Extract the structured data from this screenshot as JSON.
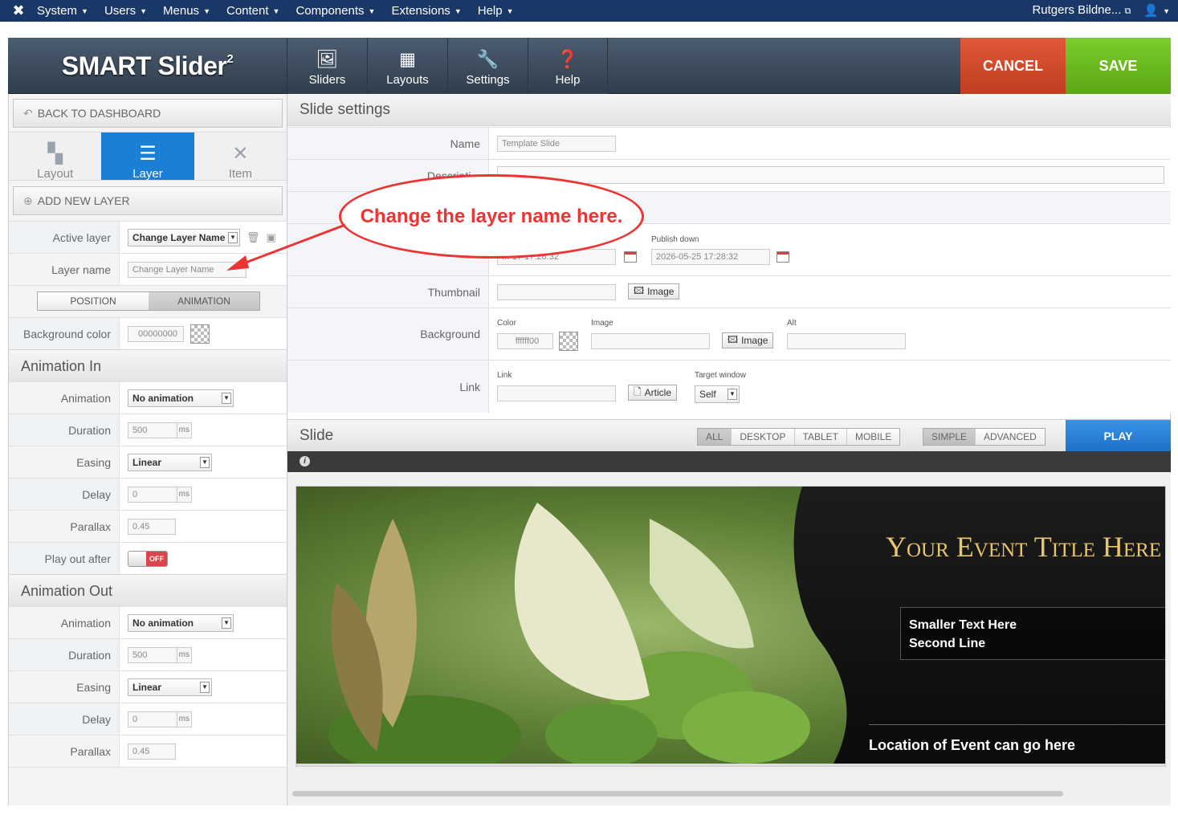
{
  "topbar": {
    "menu": [
      "System",
      "Users",
      "Menus",
      "Content",
      "Components",
      "Extensions",
      "Help"
    ],
    "user": "Rutgers Bildne...",
    "user_icon": "person-icon"
  },
  "header": {
    "brand_text": "SMART Slider",
    "brand_sup": "2",
    "nav": [
      {
        "label": "Sliders",
        "icon": "image-icon"
      },
      {
        "label": "Layouts",
        "icon": "layout-icon"
      },
      {
        "label": "Settings",
        "icon": "wrench-icon"
      },
      {
        "label": "Help",
        "icon": "question-icon"
      }
    ],
    "cancel_label": "CANCEL",
    "save_label": "SAVE"
  },
  "left": {
    "back_label": "BACK TO DASHBOARD",
    "tabs": [
      "Layout",
      "Layer",
      "Item"
    ],
    "add_layer_label": "ADD NEW LAYER",
    "active_layer_label": "Active layer",
    "active_layer_value": "Change Layer Name",
    "layer_name_label": "Layer name",
    "layer_name_value": "Change Layer Name",
    "seg": [
      "POSITION",
      "ANIMATION"
    ],
    "bg_color_label": "Background color",
    "bg_color_value": "00000000",
    "anim_in": {
      "title": "Animation In",
      "animation_label": "Animation",
      "animation_value": "No animation",
      "duration_label": "Duration",
      "duration_value": "500",
      "duration_unit": "ms",
      "easing_label": "Easing",
      "easing_value": "Linear",
      "delay_label": "Delay",
      "delay_value": "0",
      "delay_unit": "ms",
      "parallax_label": "Parallax",
      "parallax_value": "0.45",
      "playout_label": "Play out after",
      "playout_value": "OFF"
    },
    "anim_out": {
      "title": "Animation Out",
      "animation_label": "Animation",
      "animation_value": "No animation",
      "duration_label": "Duration",
      "duration_value": "500",
      "duration_unit": "ms",
      "easing_label": "Easing",
      "easing_value": "Linear",
      "delay_label": "Delay",
      "delay_value": "0",
      "delay_unit": "ms",
      "parallax_label": "Parallax",
      "parallax_value": "0.45"
    }
  },
  "right": {
    "settings_title": "Slide settings",
    "name_label": "Name",
    "name_value": "Template Slide",
    "description_label": "Descripti...",
    "publish_label": "Pu...",
    "publish_up_value": "...-17 17:28:32",
    "publish_down_label": "Publish down",
    "publish_down_value": "2026-05-25 17:28:32",
    "thumbnail_label": "Thumbnail",
    "image_btn": "Image",
    "background_label": "Background",
    "color_label": "Color",
    "color_value": "ffffff00",
    "image_label": "Image",
    "alt_label": "Alt",
    "link_label": "Link",
    "link_small_label": "Link",
    "article_btn": "Article",
    "target_label": "Target window",
    "target_value": "Self",
    "slide_title": "Slide",
    "devices": [
      "ALL",
      "DESKTOP",
      "TABLET",
      "MOBILE"
    ],
    "modes": [
      "SIMPLE",
      "ADVANCED"
    ],
    "play_label": "PLAY",
    "info_glyph": "i"
  },
  "slide": {
    "event_title": "Your Event Title Here",
    "line1": "Smaller Text Here",
    "line2": "Second Line",
    "location": "Location of Event can go here"
  },
  "callout": "Change the layer name here."
}
